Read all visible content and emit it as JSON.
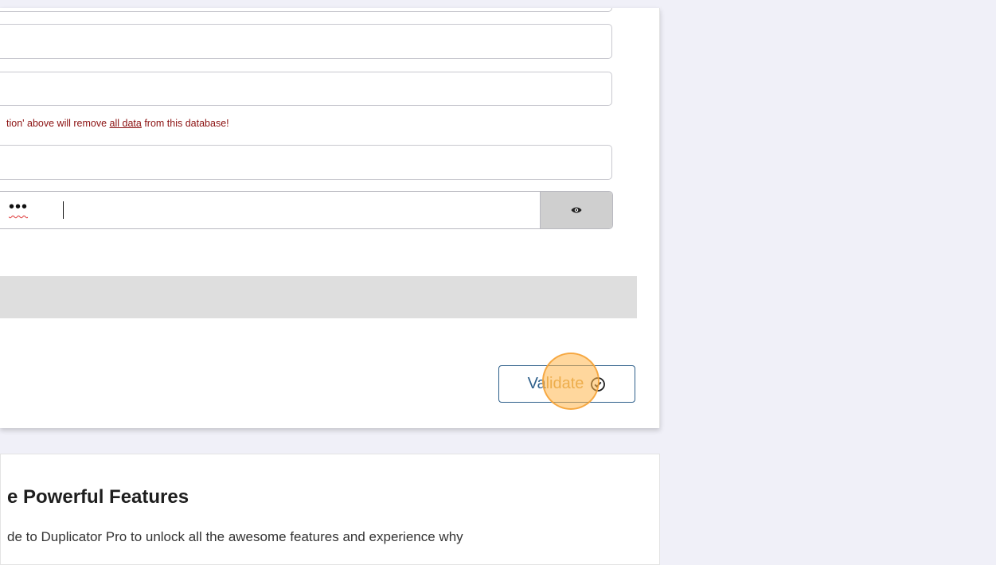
{
  "form": {
    "warning": {
      "prefix": "tion' above will remove ",
      "link": "all data",
      "suffix": " from this database!"
    },
    "password": {
      "value": "•••",
      "toggle_icon": "eye-icon"
    },
    "validate": {
      "label_a": "Va",
      "label_b": "lidate",
      "icon": "check-circle-icon"
    }
  },
  "promo": {
    "title": "e Powerful Features",
    "text": "de to Duplicator Pro to unlock all the awesome features and experience why"
  },
  "colors": {
    "page_bg": "#f0f0f8",
    "warning": "#8b1010",
    "button_accent": "#2d5f8a",
    "click_marker": "#ffb74d"
  }
}
